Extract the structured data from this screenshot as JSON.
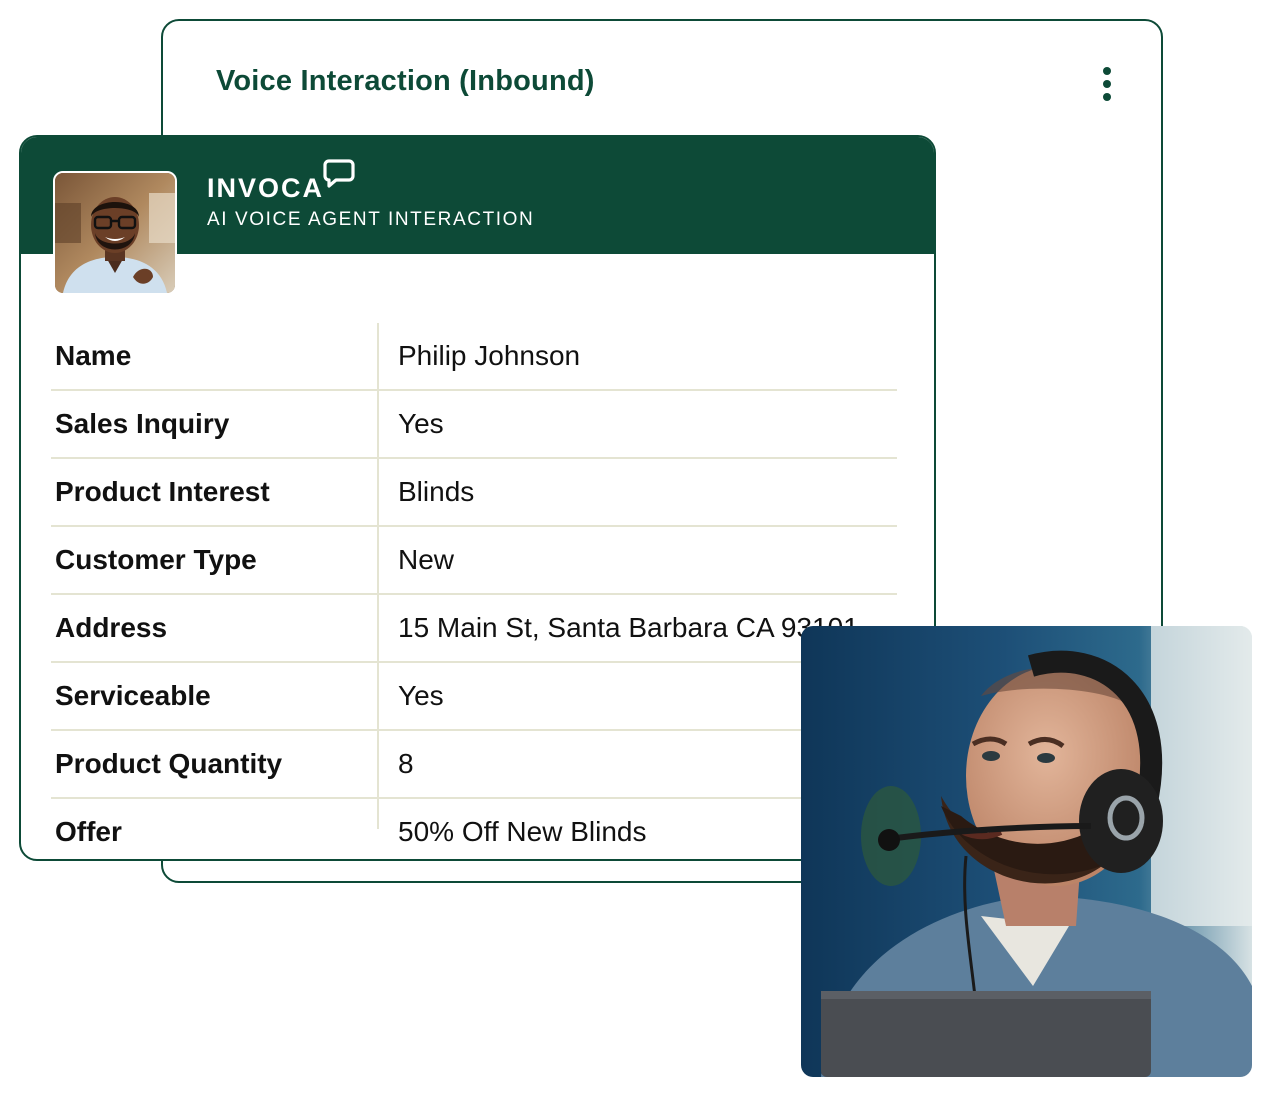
{
  "back_card": {
    "title": "Voice Interaction (Inbound)"
  },
  "front_card": {
    "brand": "INVOCA",
    "subtitle": "AI VOICE AGENT INTERACTION",
    "rows": [
      {
        "label": "Name",
        "value": "Philip Johnson"
      },
      {
        "label": "Sales Inquiry",
        "value": "Yes"
      },
      {
        "label": "Product Interest",
        "value": "Blinds"
      },
      {
        "label": "Customer Type",
        "value": "New"
      },
      {
        "label": "Address",
        "value": "15 Main St, Santa Barbara CA 93101"
      },
      {
        "label": "Serviceable",
        "value": "Yes"
      },
      {
        "label": "Product Quantity",
        "value": "8"
      },
      {
        "label": "Offer",
        "value": "50% Off New Blinds"
      }
    ]
  },
  "icons": {
    "menu": "kebab-menu-icon",
    "brand_mark": "speech-bubble-icon"
  },
  "colors": {
    "brand_green": "#0d4a37",
    "divider": "#e4e4d2",
    "text": "#111111"
  }
}
